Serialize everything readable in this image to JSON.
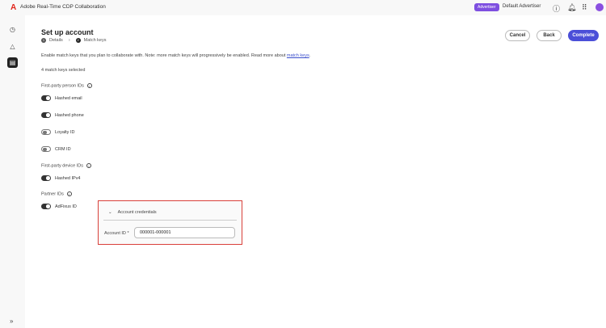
{
  "app": {
    "title": "Adobe Real-Time CDP Collaboration",
    "role_badge": "Advertiser",
    "account": "Default Advertiser"
  },
  "page": {
    "title": "Set up account",
    "steps": [
      {
        "num": "1",
        "label": "Details"
      },
      {
        "num": "2",
        "label": "Match keys"
      }
    ],
    "description": "Enable match keys that you plan to collaborate with. Note: more match keys will progressively be enabled. Read more about ",
    "description_link": "match keys",
    "description_end": ".",
    "selected_count": "4 match keys selected"
  },
  "buttons": {
    "cancel": "Cancel",
    "back": "Back",
    "complete": "Complete"
  },
  "sections": [
    {
      "title": "First-party person IDs",
      "items": [
        {
          "label": "Hashed email",
          "on": true
        },
        {
          "label": "Hashed phone",
          "on": true
        },
        {
          "label": "Loyalty ID",
          "on": false
        },
        {
          "label": "CRM ID",
          "on": false
        }
      ]
    },
    {
      "title": "First-party device IDs",
      "items": [
        {
          "label": "Hashed IPv4",
          "on": true
        }
      ]
    },
    {
      "title": "Partner IDs",
      "items": [
        {
          "label": "AdFixus ID",
          "on": true
        }
      ]
    }
  ],
  "credentials": {
    "title": "Account credentials",
    "field_label": "Account ID",
    "required": "*",
    "value": "000001-000001"
  }
}
